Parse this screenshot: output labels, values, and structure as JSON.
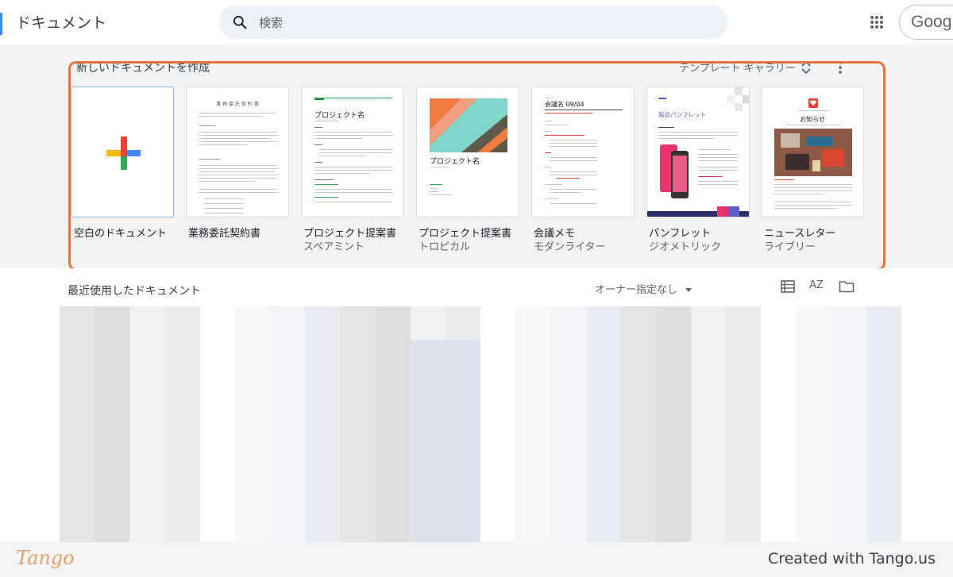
{
  "header": {
    "app_title": "ドキュメント",
    "search_placeholder": "検索",
    "account_button_label": "Goog"
  },
  "templates": {
    "heading": "新しいドキュメントを作成",
    "gallery_label": "テンプレート ギャラリー",
    "items": [
      {
        "name": "空白のドキュメント",
        "sub": ""
      },
      {
        "name": "業務委託契約書",
        "sub": ""
      },
      {
        "name": "プロジェクト提案書",
        "sub": "スペアミント"
      },
      {
        "name": "プロジェクト提案書",
        "sub": "トロピカル"
      },
      {
        "name": "会議メモ",
        "sub": "モダンライター"
      },
      {
        "name": "パンフレット",
        "sub": "ジオメトリック"
      },
      {
        "name": "ニュースレター",
        "sub": "ライブリー"
      }
    ],
    "thumb_text": {
      "contract_title": "業 務 委 託 契 約 書",
      "spearmint_title": "プロジェクト名",
      "tropical_title": "プロジェクト名",
      "meeting_title": "会議名 09/04",
      "brochure_title": "製品パンフレット",
      "newsletter_title": "お知らせ"
    }
  },
  "recent": {
    "title": "最近使用したドキュメント",
    "owner_filter": "オーナー指定なし",
    "sort_label": "AZ"
  },
  "footer": {
    "logo": "Tango",
    "credit": "Created with Tango.us"
  },
  "colors": {
    "highlight": "#e8743b",
    "accent": "#4285f4"
  }
}
